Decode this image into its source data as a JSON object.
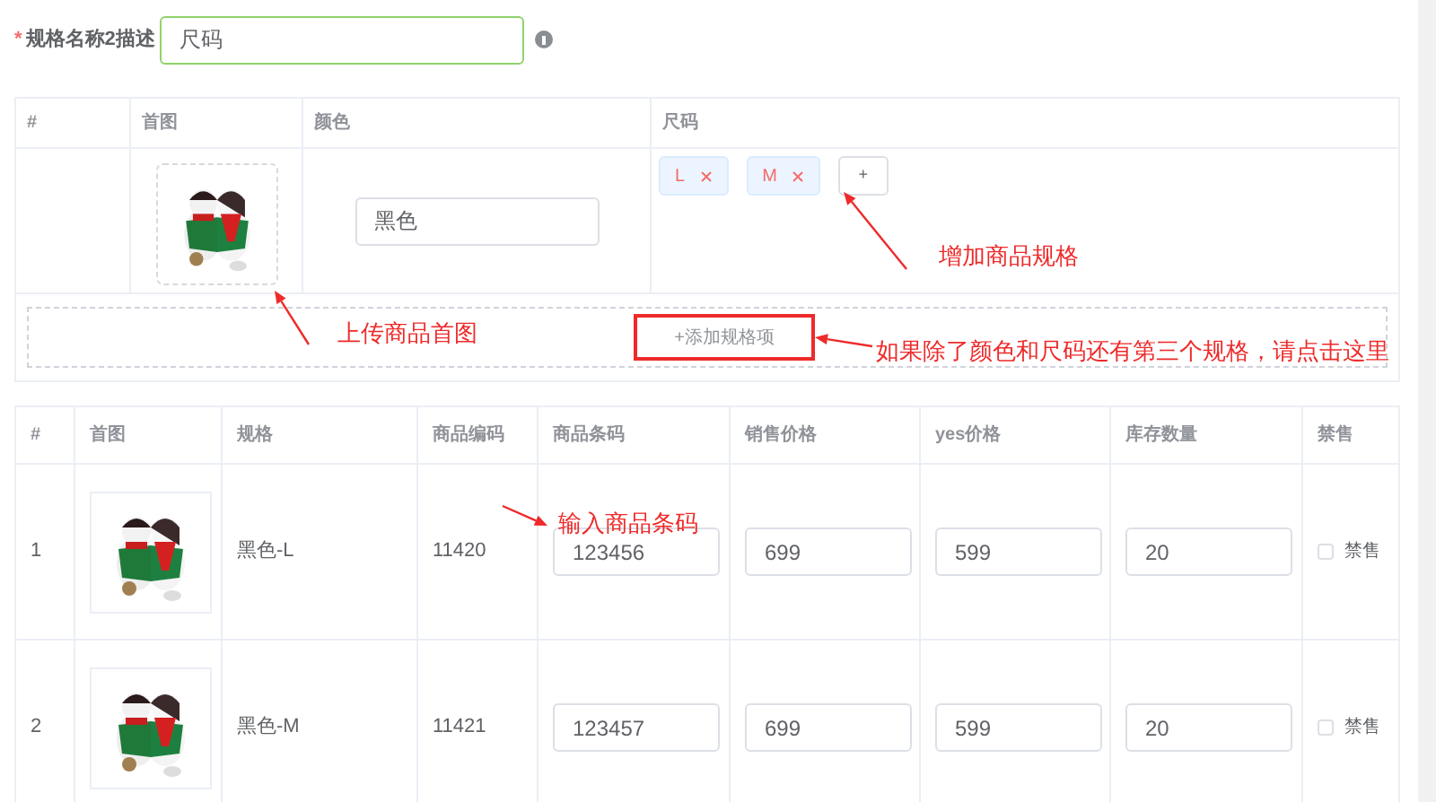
{
  "spec_name_field": {
    "required_mark": "*",
    "label": "规格名称2描述",
    "value": "尺码",
    "focused": true
  },
  "spec_table": {
    "columns": [
      "#",
      "首图",
      "颜色",
      "尺码"
    ],
    "row": {
      "color_value": "黑色",
      "size_tags": [
        "L",
        "M"
      ],
      "add_tag_button": "+"
    },
    "add_spec_button": "+添加规格项"
  },
  "sku_table": {
    "columns": [
      "#",
      "首图",
      "规格",
      "商品编码",
      "商品条码",
      "销售价格",
      "yes价格",
      "库存数量",
      "禁售"
    ],
    "rows": [
      {
        "index": "1",
        "spec": "黑色-L",
        "code": "11420",
        "barcode": "123456",
        "sale_price": "699",
        "yes_price": "599",
        "stock": "20",
        "banned": false,
        "banned_label": "禁售"
      },
      {
        "index": "2",
        "spec": "黑色-M",
        "code": "11421",
        "barcode": "123457",
        "sale_price": "699",
        "yes_price": "599",
        "stock": "20",
        "banned": false,
        "banned_label": "禁售"
      }
    ]
  },
  "annotations": [
    {
      "text": "上传商品首图"
    },
    {
      "text": "增加商品规格"
    },
    {
      "text": "如果除了颜色和尺码还有第三个规格，请点击这里"
    },
    {
      "text": "输入商品条码"
    }
  ]
}
